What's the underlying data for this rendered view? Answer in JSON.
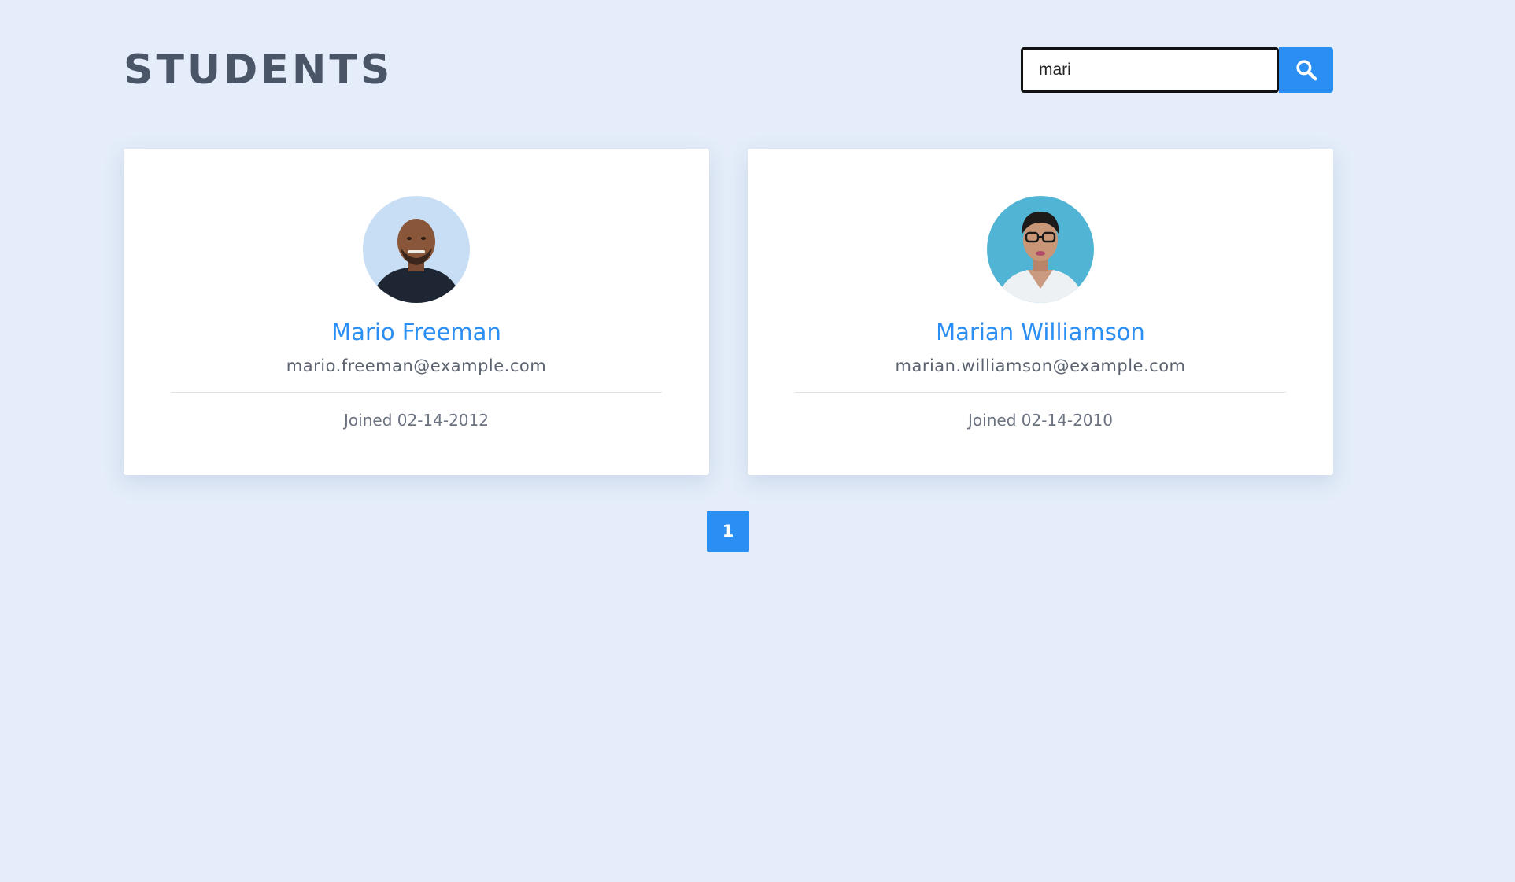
{
  "header": {
    "title": "STUDENTS"
  },
  "search": {
    "value": "mari",
    "icon": "search-icon",
    "button_color": "#2a8ef3"
  },
  "students": [
    {
      "name": "Mario Freeman",
      "email": "mario.freeman@example.com",
      "joined": "Joined 02-14-2012",
      "avatar": "avatar-photo"
    },
    {
      "name": "Marian Williamson",
      "email": "marian.williamson@example.com",
      "joined": "Joined 02-14-2010",
      "avatar": "avatar-photo"
    }
  ],
  "pagination": {
    "pages": [
      "1"
    ],
    "current": "1"
  },
  "colors": {
    "background": "#e4edf9",
    "accent": "#2a8ef3",
    "title": "#4a5568"
  }
}
